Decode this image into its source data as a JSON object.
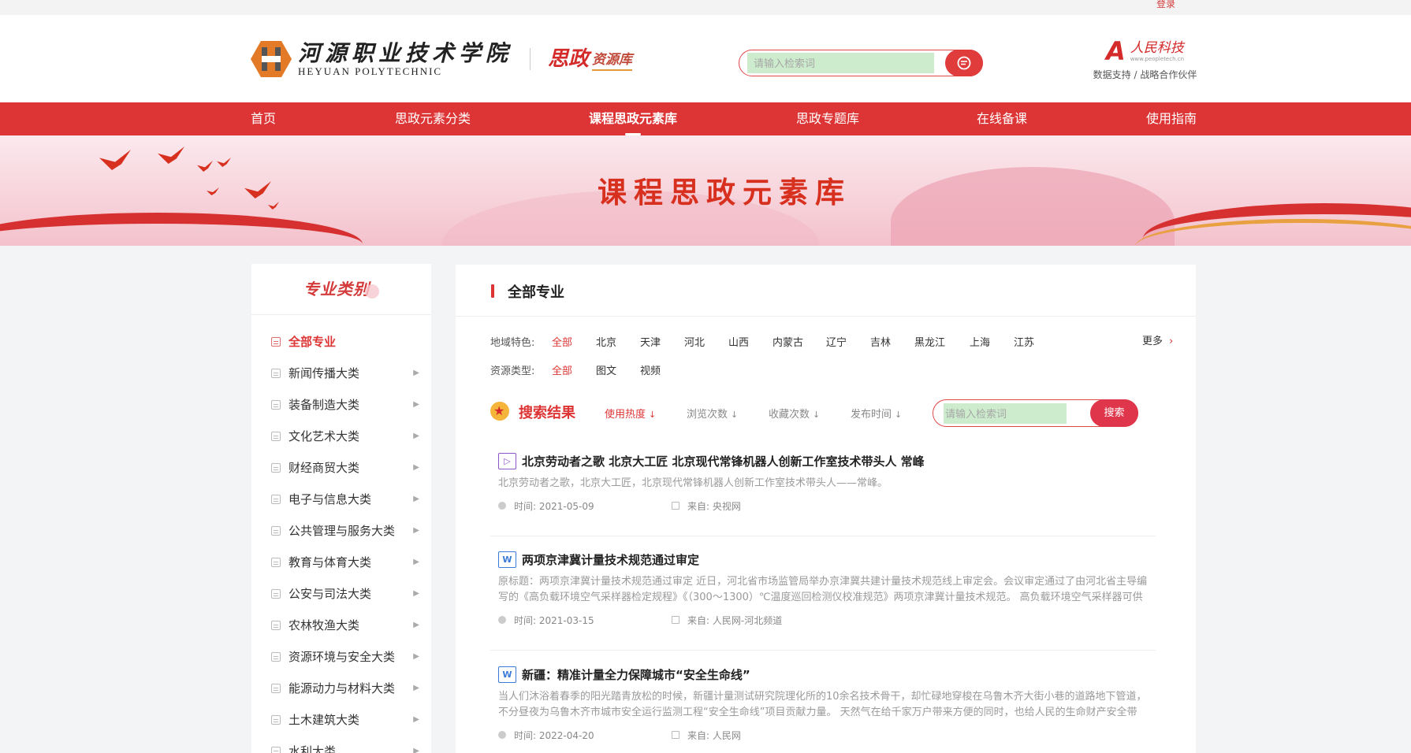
{
  "topbar": {
    "login": "登录"
  },
  "header": {
    "logo_cn": "河源职业技术学院",
    "logo_en": "HEYUAN POLYTECHNIC",
    "sz_big": "思政",
    "sz_small": "资源库",
    "search_placeholder": "请输入检索词",
    "partner_mark": "A",
    "partner_name": "人民科技",
    "partner_url": "www.peopletech.cn",
    "partner_note": "数据支持 / 战略合作伙伴"
  },
  "nav": [
    "首页",
    "思政元素分类",
    "课程思政元素库",
    "思政专题库",
    "在线备课",
    "使用指南"
  ],
  "nav_active": "课程思政元素库",
  "banner": {
    "title": "课程思政元素库"
  },
  "sidebar": {
    "title": "专业类别",
    "items": [
      {
        "label": "全部专业",
        "active": true
      },
      {
        "label": "新闻传播大类"
      },
      {
        "label": "装备制造大类"
      },
      {
        "label": "文化艺术大类"
      },
      {
        "label": "财经商贸大类"
      },
      {
        "label": "电子与信息大类"
      },
      {
        "label": "公共管理与服务大类"
      },
      {
        "label": "教育与体育大类"
      },
      {
        "label": "公安与司法大类"
      },
      {
        "label": "农林牧渔大类"
      },
      {
        "label": "资源环境与安全大类"
      },
      {
        "label": "能源动力与材料大类"
      },
      {
        "label": "土木建筑大类"
      },
      {
        "label": "水利大类"
      }
    ]
  },
  "main": {
    "title": "全部专业",
    "region_label": "地域特色:",
    "regions": [
      "全部",
      "北京",
      "天津",
      "河北",
      "山西",
      "内蒙古",
      "辽宁",
      "吉林",
      "黑龙江",
      "上海",
      "江苏"
    ],
    "more": "更多",
    "type_label": "资源类型:",
    "types": [
      "全部",
      "图文",
      "视频"
    ],
    "result_title": "搜索结果",
    "sorts": [
      "使用热度",
      "浏览次数",
      "收藏次数",
      "发布时间"
    ],
    "search_placeholder": "请输入检索词",
    "search_button": "搜索",
    "results": [
      {
        "type": "video",
        "title": "北京劳动者之歌 北京大工匠 北京现代常锋机器人创新工作室技术带头人 常峰",
        "desc": "北京劳动者之歌，北京大工匠，北京现代常锋机器人创新工作室技术带头人——常峰。",
        "time": "时间:  2021-05-09",
        "source": "来自:  央视网"
      },
      {
        "type": "doc",
        "title": "两项京津冀计量技术规范通过审定",
        "desc": "原标题：两项京津冀计量技术规范通过审定 近日，河北省市场监管局举办京津冀共建计量技术规范线上审定会。会议审定通过了由河北省主导编写的《高负载环境空气采样器检定规程》《（300～1300）℃温度巡回检测仪校准规范》两项京津冀计量技术规范。 高负载环境空气采样器可供环...",
        "time": "时间:  2021-03-15",
        "source": "来自:  人民网-河北频道"
      },
      {
        "type": "doc",
        "title": "新疆：精准计量全力保障城市“安全生命线”",
        "desc": "当人们沐浴着春季的阳光踏青放松的时候，新疆计量测试研究院理化所的10余名技术骨干，却忙碌地穿梭在乌鲁木齐大街小巷的道路地下管道，不分昼夜为乌鲁木齐市城市安全运行监测工程“安全生命线”项目贡献力量。 天然气在给千家万户带来方便的同时，也给人民的生命财产安全带来...",
        "time": "时间:  2022-04-20",
        "source": "来自:  人民网"
      }
    ]
  },
  "colors": {
    "brand_red": "#dd3535",
    "banner_pink": "#f7d2da"
  }
}
